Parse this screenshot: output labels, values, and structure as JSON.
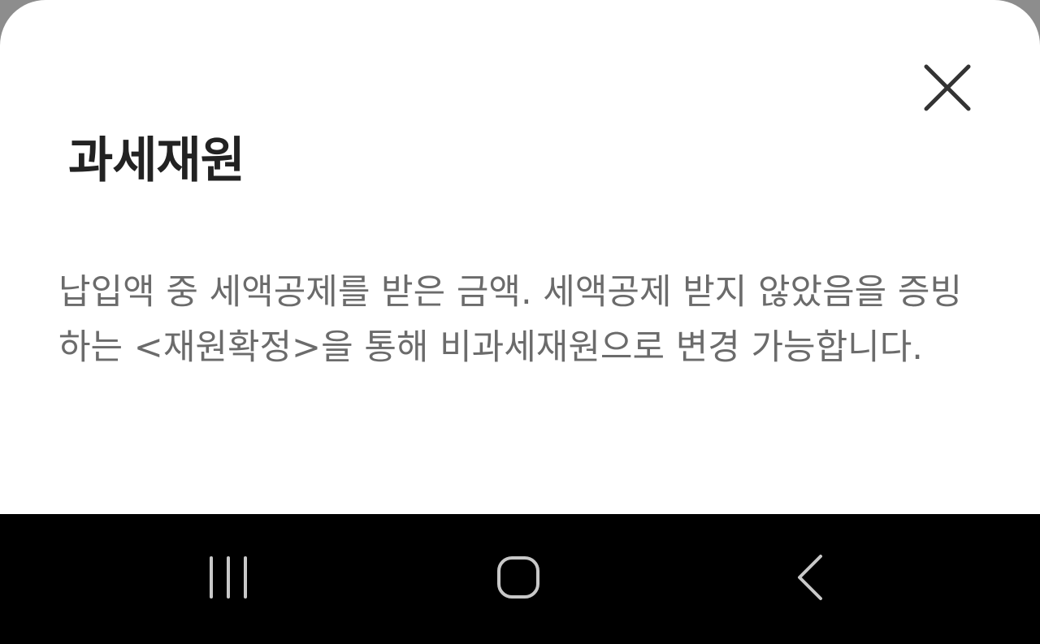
{
  "dialog": {
    "title": "과세재원",
    "description": "납입액 중 세액공제를 받은 금액. 세액공제 받지 않았음을 증빙하는 <재원확정>을 통해 비과세재원으로 변경 가능합니다.",
    "close_icon": "close-icon"
  },
  "navigation_bar": {
    "recents_icon": "recent-apps-icon",
    "home_icon": "home-icon",
    "back_icon": "back-icon"
  },
  "colors": {
    "sheet_background": "#ffffff",
    "title_text": "#222222",
    "body_text": "#6b6b6b",
    "navbar_background": "#000000",
    "nav_icon": "#c8c8c8",
    "overlay": "#8d8d8d"
  }
}
